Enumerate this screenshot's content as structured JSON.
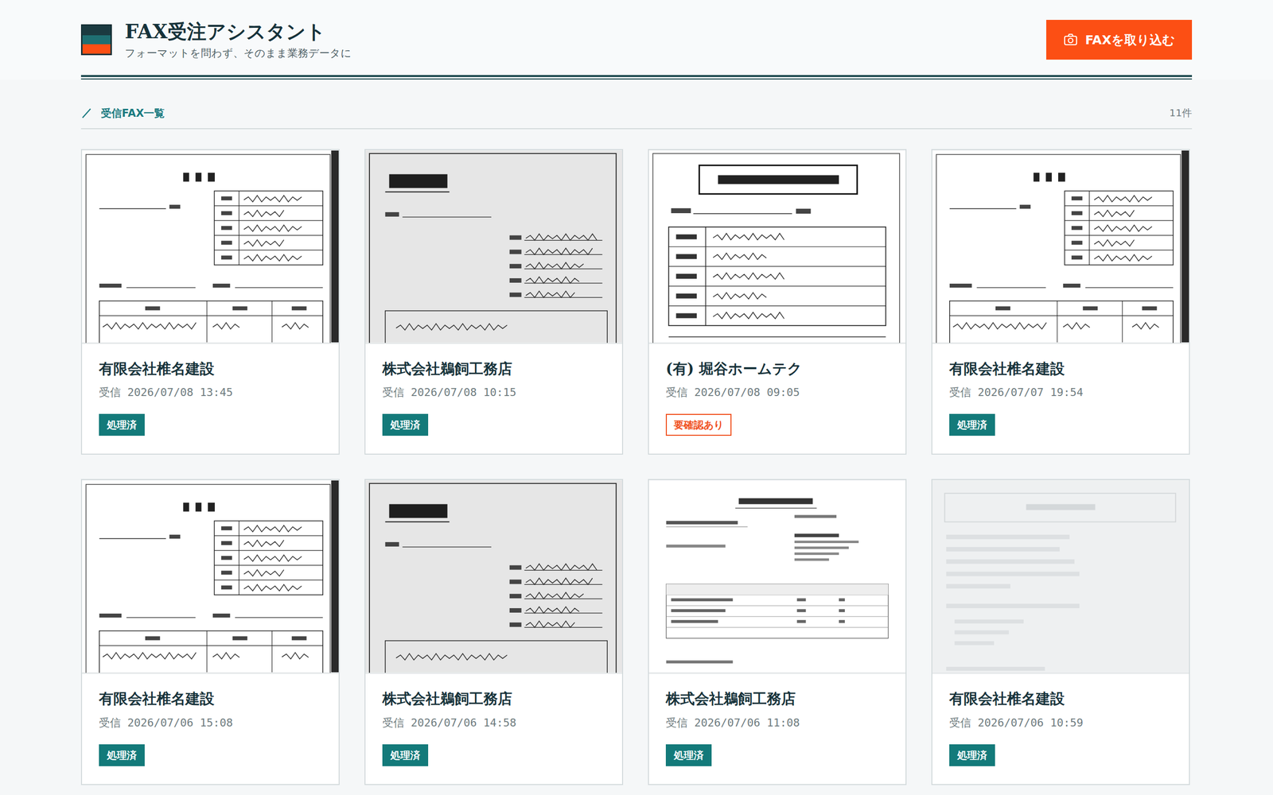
{
  "header": {
    "title": "FAX受注アシスタント",
    "subtitle": "フォーマットを問わず、そのまま業務データに"
  },
  "import_button": {
    "label": "FAXを取り込む"
  },
  "section": {
    "title": "受信FAX一覧",
    "count": "11件"
  },
  "cards": [
    {
      "company": "有限会社椎名建設",
      "received": "受信 2026/07/08 13:45",
      "status": {
        "label": "処理済",
        "kind": "done"
      },
      "preview": "chumon"
    },
    {
      "company": "株式会社鵜飼工務店",
      "received": "受信 2026/07/08 10:15",
      "status": {
        "label": "処理済",
        "kind": "done"
      },
      "preview": "hatchu"
    },
    {
      "company": "(有) 堀谷ホームテク",
      "received": "受信 2026/07/08 09:05",
      "status": {
        "label": "要確認あり",
        "kind": "warn"
      },
      "preview": "renraku"
    },
    {
      "company": "有限会社椎名建設",
      "received": "受信 2026/07/07 19:54",
      "status": {
        "label": "処理済",
        "kind": "done"
      },
      "preview": "chumon"
    },
    {
      "company": "有限会社椎名建設",
      "received": "受信 2026/07/06 15:08",
      "status": {
        "label": "処理済",
        "kind": "done"
      },
      "preview": "chumon"
    },
    {
      "company": "株式会社鵜飼工務店",
      "received": "受信 2026/07/06 14:58",
      "status": {
        "label": "処理済",
        "kind": "done"
      },
      "preview": "hatchu"
    },
    {
      "company": "株式会社鵜飼工務店",
      "received": "受信 2026/07/06 11:08",
      "status": {
        "label": "処理済",
        "kind": "done"
      },
      "preview": "typed"
    },
    {
      "company": "有限会社椎名建設",
      "received": "受信 2026/07/06 10:59",
      "status": {
        "label": "処理済",
        "kind": "done"
      },
      "preview": "faint"
    }
  ]
}
